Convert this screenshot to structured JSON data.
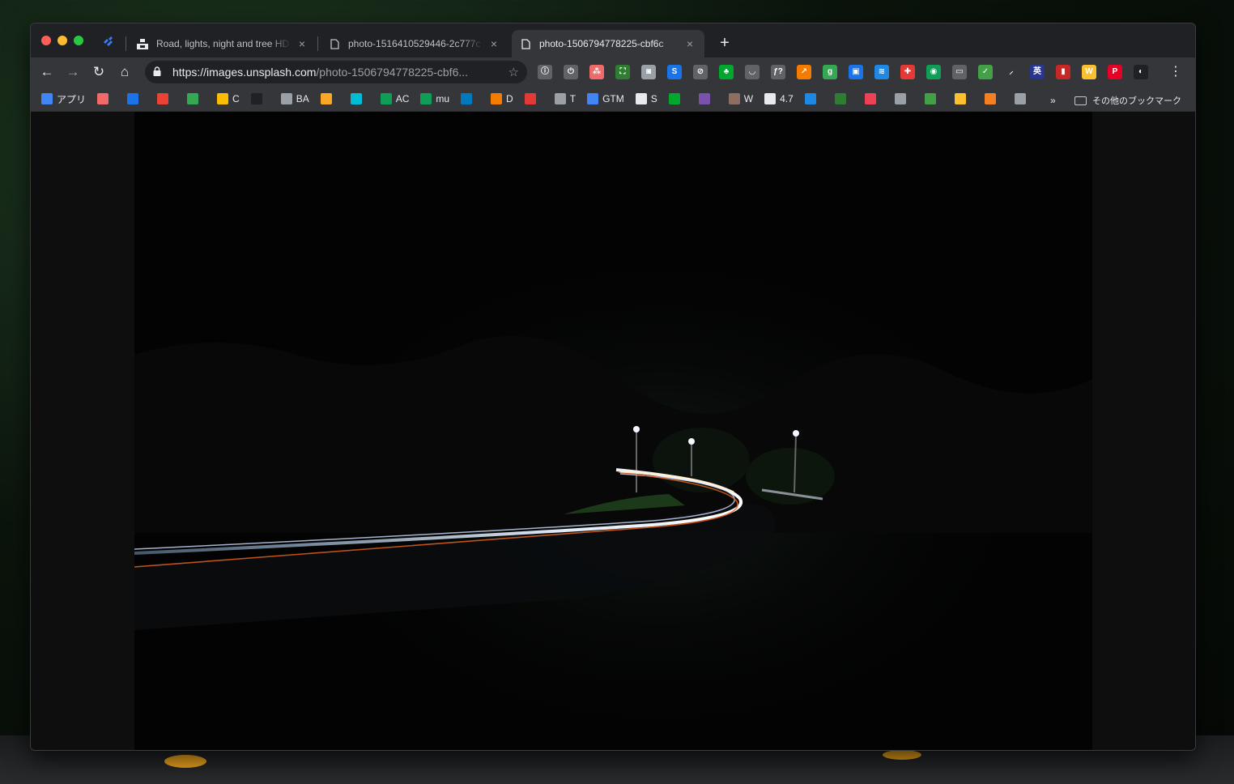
{
  "browser": {
    "tabs": [
      {
        "title": "Road, lights, night and tree HD",
        "active": false
      },
      {
        "title": "photo-1516410529446-2c777c",
        "active": false
      },
      {
        "title": "photo-1506794778225-cbf6c",
        "active": true
      }
    ],
    "close_glyph": "×",
    "new_tab_glyph": "+",
    "url_host": "https://images.unsplash.com",
    "url_path": "/photo-1506794778225-cbf6...",
    "star_glyph": "☆",
    "menu_glyph": "⋮"
  },
  "bookmarks": {
    "items": [
      {
        "label": "アプリ",
        "icon": "apps-grid-icon",
        "color": "#4285f4"
      },
      {
        "label": "",
        "icon": "asana-icon",
        "color": "#f06a6a"
      },
      {
        "label": "",
        "icon": "calendar-icon",
        "color": "#1a73e8"
      },
      {
        "label": "",
        "icon": "gmail-icon",
        "color": "#ea4335"
      },
      {
        "label": "",
        "icon": "drive-icon",
        "color": "#34a853"
      },
      {
        "label": "C",
        "icon": "drive-icon",
        "color": "#fbbc04"
      },
      {
        "label": "",
        "icon": "paw-icon",
        "color": "#202124"
      },
      {
        "label": "BA",
        "icon": "folder-icon",
        "color": "#9aa0a6"
      },
      {
        "label": "",
        "icon": "refresh-badge-icon",
        "color": "#f9a825"
      },
      {
        "label": "",
        "icon": "flag-icon",
        "color": "#00bcd4"
      },
      {
        "label": "AC",
        "icon": "plus-badge-icon",
        "color": "#0f9d58"
      },
      {
        "label": "mu",
        "icon": "plus-badge-icon",
        "color": "#0f9d58"
      },
      {
        "label": "",
        "icon": "trello-icon",
        "color": "#0079bf"
      },
      {
        "label": "D",
        "icon": "download-icon",
        "color": "#f57c00"
      },
      {
        "label": "",
        "icon": "dots-icon",
        "color": "#e53935"
      },
      {
        "label": "T",
        "icon": "page-icon",
        "color": "#9aa0a6"
      },
      {
        "label": "GTM",
        "icon": "gtm-icon",
        "color": "#4285f4"
      },
      {
        "label": "S",
        "icon": "apple-icon",
        "color": "#e8eaed"
      },
      {
        "label": "",
        "icon": "evernote-icon",
        "color": "#00a82d"
      },
      {
        "label": "",
        "icon": "b-badge-icon",
        "color": "#7b52ab"
      },
      {
        "label": "W",
        "icon": "box-icon",
        "color": "#8d6e63"
      },
      {
        "label": "4.7",
        "icon": "flag-icon",
        "color": "#e8eaed"
      },
      {
        "label": "",
        "icon": "flag-blue-icon",
        "color": "#1e88e5"
      },
      {
        "label": "",
        "icon": "screen-icon",
        "color": "#2e7d32"
      },
      {
        "label": "",
        "icon": "pocket-icon",
        "color": "#ef4056"
      },
      {
        "label": "",
        "icon": "page-icon",
        "color": "#9aa0a6"
      },
      {
        "label": "",
        "icon": "search-green-icon",
        "color": "#43a047"
      },
      {
        "label": "",
        "icon": "lambda-icon",
        "color": "#fbc02d"
      },
      {
        "label": "",
        "icon": "stack-icon",
        "color": "#f48024"
      },
      {
        "label": "",
        "icon": "page-icon",
        "color": "#9aa0a6"
      }
    ],
    "more_label": "»",
    "other_label": "その他のブックマーク"
  },
  "extensions": [
    {
      "icon": "info-icon",
      "glyph": "ⓘ",
      "color": "#5f6368"
    },
    {
      "icon": "power-icon",
      "glyph": "⏻",
      "color": "#5f6368"
    },
    {
      "icon": "asana-icon",
      "glyph": "⁂",
      "color": "#f06a6a"
    },
    {
      "icon": "crop-icon",
      "glyph": "⛶",
      "color": "#2e7d32"
    },
    {
      "icon": "camera-icon",
      "glyph": "◙",
      "color": "#9aa0a6"
    },
    {
      "icon": "s-icon",
      "glyph": "S",
      "color": "#1a73e8"
    },
    {
      "icon": "block-icon",
      "glyph": "⊘",
      "color": "#5f6368"
    },
    {
      "icon": "evernote-icon",
      "glyph": "♣",
      "color": "#00a82d"
    },
    {
      "icon": "pocket-icon",
      "glyph": "◡",
      "color": "#5f6368"
    },
    {
      "icon": "function-icon",
      "glyph": "ƒ?",
      "color": "#5f6368"
    },
    {
      "icon": "chart-icon",
      "glyph": "↗",
      "color": "#f57c00"
    },
    {
      "icon": "google-plus-icon",
      "glyph": "g",
      "color": "#34a853"
    },
    {
      "icon": "window-icon",
      "glyph": "▣",
      "color": "#1a73e8"
    },
    {
      "icon": "layers-icon",
      "glyph": "≋",
      "color": "#1e88e5"
    },
    {
      "icon": "cross-icon",
      "glyph": "✚",
      "color": "#e53935"
    },
    {
      "icon": "circle-icon",
      "glyph": "◉",
      "color": "#0f9d58"
    },
    {
      "icon": "comment-icon",
      "glyph": "▭",
      "color": "#5f6368"
    },
    {
      "icon": "check-icon",
      "glyph": "✓",
      "color": "#43a047"
    },
    {
      "icon": "feather-icon",
      "glyph": "⸝",
      "color": "#35363a"
    },
    {
      "icon": "translate-icon",
      "glyph": "英",
      "color": "#283593"
    },
    {
      "icon": "bookmark-icon",
      "glyph": "▮",
      "color": "#c62828"
    },
    {
      "icon": "w-icon",
      "glyph": "W",
      "color": "#fbc02d"
    },
    {
      "icon": "pinterest-icon",
      "glyph": "P",
      "color": "#e60023"
    },
    {
      "icon": "profile-icon",
      "glyph": "◐",
      "color": "#202124"
    }
  ]
}
